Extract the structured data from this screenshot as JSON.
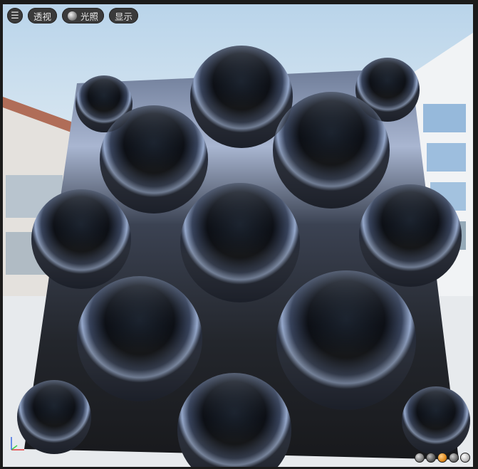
{
  "toolbar": {
    "menu_icon": "hamburger-icon",
    "perspective_label": "透视",
    "lighting_label": "光照",
    "display_label": "显示"
  },
  "preview_spheres": [
    {
      "name": "sphere-grey",
      "color": "#7f7f7f"
    },
    {
      "name": "sphere-dark",
      "color": "#5a5a5a"
    },
    {
      "name": "sphere-orange",
      "color": "#e08a1e"
    },
    {
      "name": "sphere-mid",
      "color": "#6e6e6e"
    },
    {
      "name": "sphere-light",
      "color": "#bdbdbd"
    }
  ],
  "colors": {
    "panel": "#3a3a3a",
    "sky": "#b9d4ea",
    "material_base": "#141820",
    "highlight": "#c9d6ec"
  }
}
